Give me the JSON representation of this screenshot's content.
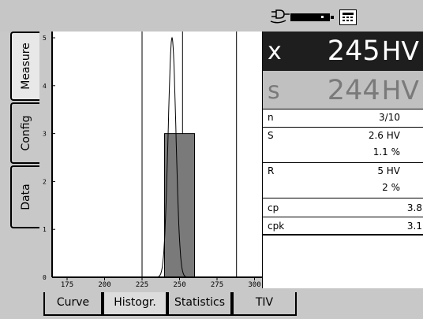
{
  "status": {
    "power_icon": "plug-icon",
    "battery_icon": "battery-icon",
    "calculator_icon": "calculator-icon"
  },
  "side_tabs": [
    {
      "label": "Measure",
      "active": true
    },
    {
      "label": "Config",
      "active": false
    },
    {
      "label": "Data",
      "active": false
    }
  ],
  "results": {
    "mean": {
      "label": "x",
      "value": "245",
      "unit": "HV"
    },
    "std": {
      "label": "s",
      "value": "244",
      "unit": "HV"
    },
    "rows": [
      {
        "label": "n",
        "value": "3/10"
      },
      {
        "label": "S",
        "value": "2.6 HV"
      },
      {
        "label": "",
        "value": "1.1 %"
      },
      {
        "label": "R",
        "value": "5 HV"
      },
      {
        "label": "",
        "value": "2 %"
      },
      {
        "label": "cp",
        "value": "3.8"
      },
      {
        "label": "cpk",
        "value": "3.1"
      }
    ]
  },
  "bottom_tabs": [
    {
      "label": "Curve",
      "active": false
    },
    {
      "label": "Histogr.",
      "active": true
    },
    {
      "label": "Statistics",
      "active": false
    },
    {
      "label": "TIV",
      "active": false
    }
  ],
  "chart_data": {
    "type": "bar",
    "x_ticks": [
      "175",
      "200",
      "225",
      "250",
      "275",
      "300"
    ],
    "y_ticks": [
      "0",
      "1",
      "2",
      "3",
      "4",
      "5"
    ],
    "xlim": [
      165,
      305
    ],
    "ylim": [
      0,
      5
    ],
    "bins": [
      {
        "from": 240,
        "to": 250,
        "count": 3
      }
    ],
    "reference_lines": [
      225,
      252,
      288
    ],
    "normal_curve": {
      "mean": 245,
      "sd": 2.6,
      "peak": 5
    },
    "grid": false
  }
}
